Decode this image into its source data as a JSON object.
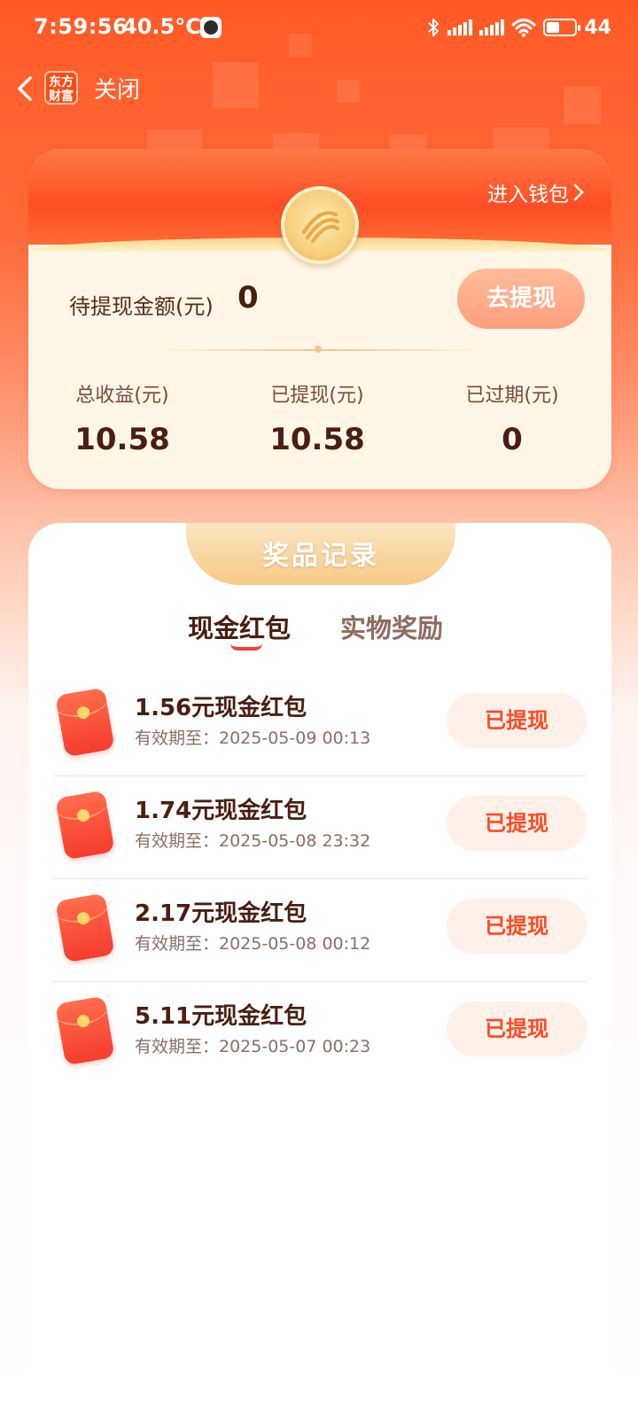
{
  "status_bar": {
    "time": "7:59:56",
    "temperature": "40.5°C",
    "battery": "44"
  },
  "nav": {
    "logo_text_line1": "东方",
    "logo_text_line2": "财富",
    "close_label": "关闭"
  },
  "wallet": {
    "enter_wallet_label": "进入钱包",
    "pending_label": "待提现金额(元)",
    "pending_value": "0",
    "withdraw_button": "去提现",
    "stats": [
      {
        "label": "总收益(元)",
        "value": "10.58"
      },
      {
        "label": "已提现(元)",
        "value": "10.58"
      },
      {
        "label": "已过期(元)",
        "value": "0"
      }
    ]
  },
  "records": {
    "title": "奖品记录",
    "tabs": [
      "现金红包",
      "实物奖励"
    ],
    "active_tab": "现金红包",
    "items": [
      {
        "title": "1.56元现金红包",
        "expiry": "有效期至：2025-05-09 00:13",
        "status": "已提现"
      },
      {
        "title": "1.74元现金红包",
        "expiry": "有效期至：2025-05-08 23:32",
        "status": "已提现"
      },
      {
        "title": "2.17元现金红包",
        "expiry": "有效期至：2025-05-08 00:12",
        "status": "已提现"
      },
      {
        "title": "5.11元现金红包",
        "expiry": "有效期至：2025-05-07 00:23",
        "status": "已提现"
      }
    ]
  },
  "colors": {
    "header_orange": "#ff5a26",
    "accent_red": "#ff4a22",
    "gold": "#f6c985"
  }
}
